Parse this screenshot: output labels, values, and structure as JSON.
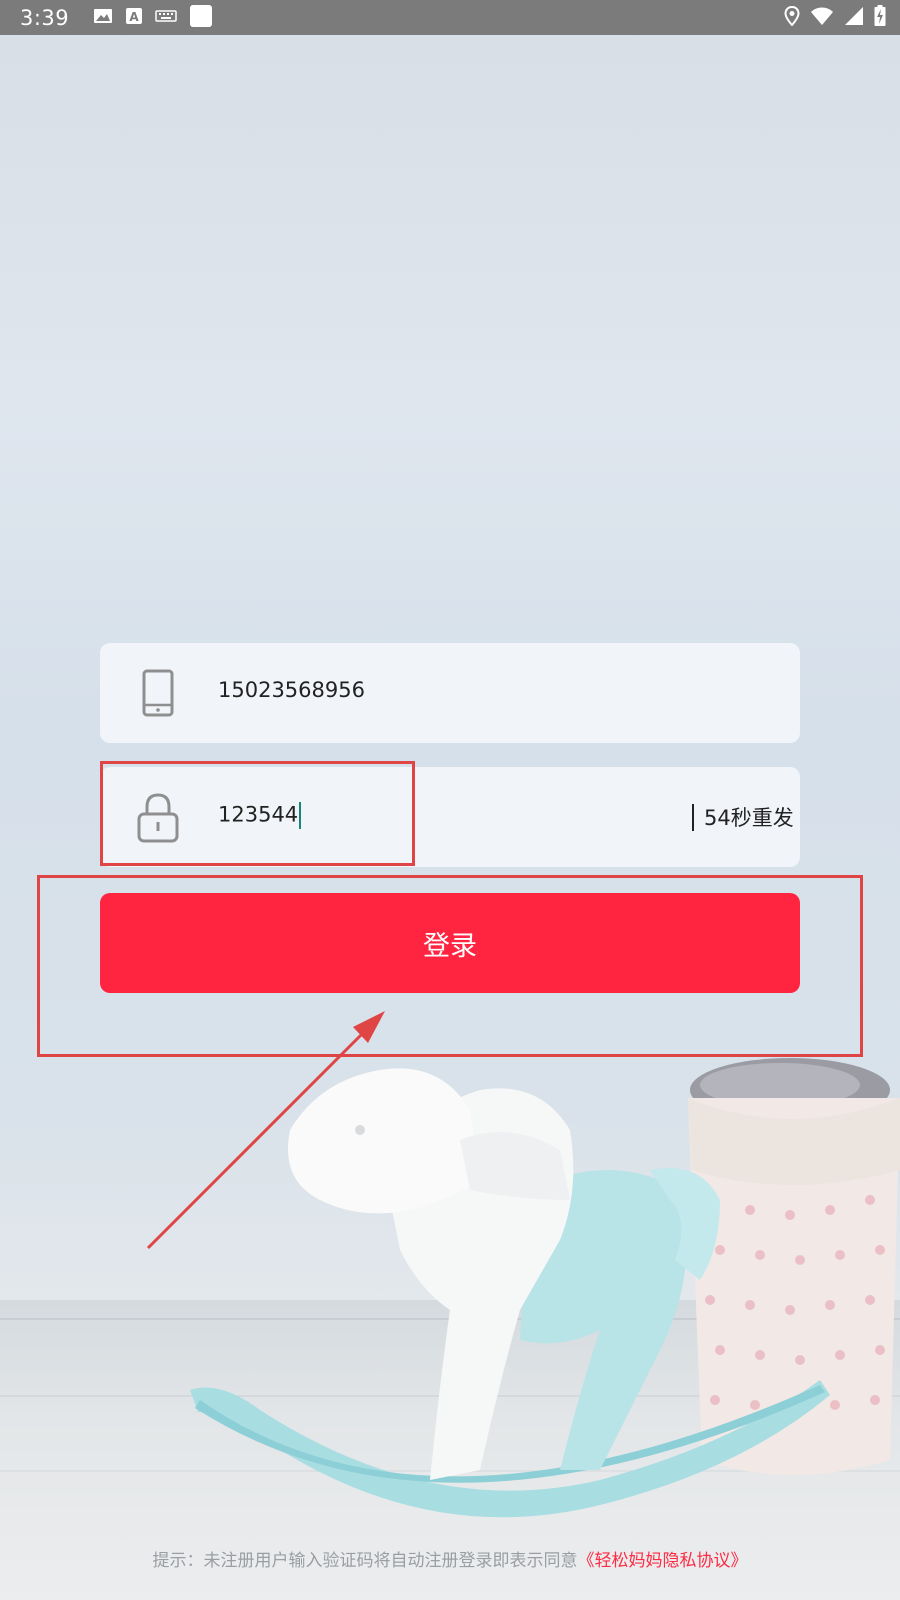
{
  "status_bar": {
    "time": "3:39",
    "icons_left": [
      "image-icon",
      "font-a-icon",
      "keyboard-icon",
      "white-square-icon"
    ],
    "icons_right": [
      "location-icon",
      "wifi-icon",
      "cell-signal-icon",
      "battery-charging-icon"
    ]
  },
  "form": {
    "phone": {
      "icon": "phone-icon",
      "value": "15023568956"
    },
    "code": {
      "icon": "lock-icon",
      "value": "123544",
      "resend_label": "54秒重发"
    },
    "login_label": "登录"
  },
  "footer": {
    "hint": "提示：未注册用户输入验证码将自动注册登录即表示同意",
    "link": "《轻松妈妈隐私协议》"
  },
  "colors": {
    "brand": "#ff2540",
    "annotation": "#e04545",
    "status_bar": "#7b7b7b"
  }
}
